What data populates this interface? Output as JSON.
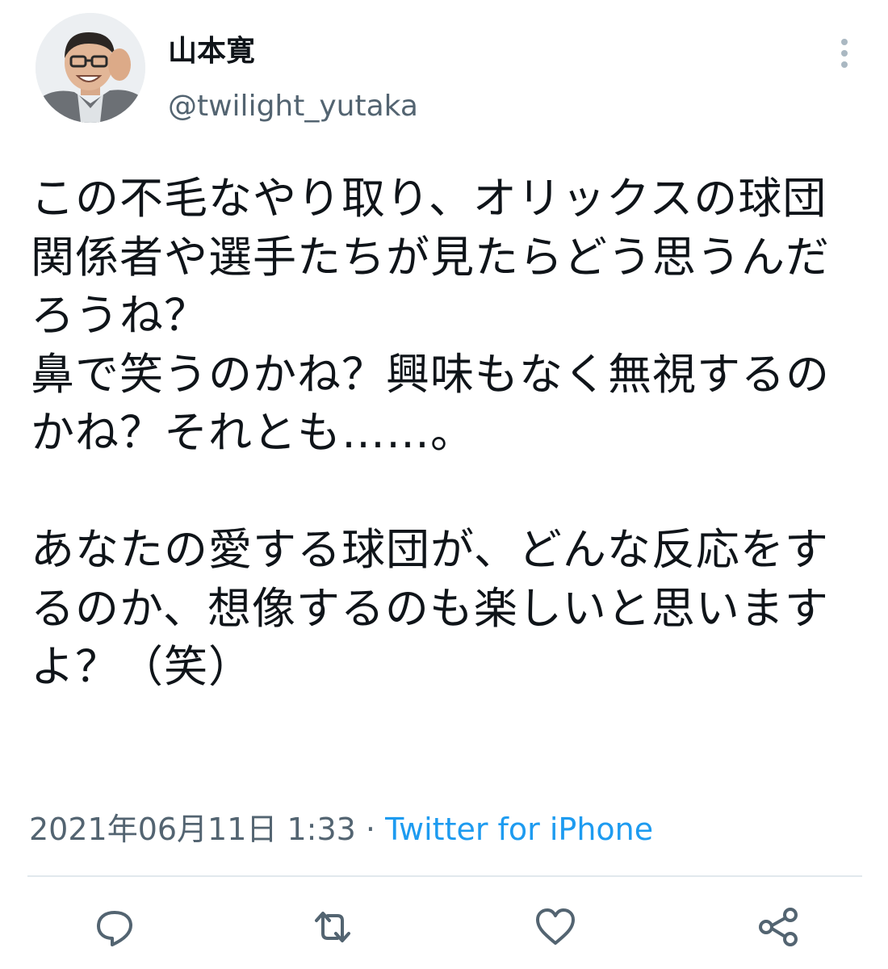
{
  "author": {
    "name": "山本寛",
    "handle": "@twilight_yutaka"
  },
  "tweet": {
    "text": "この不毛なやり取り、オリックスの球団関係者や選手たちが見たらどう思うんだろうね？\n鼻で笑うのかね？興味もなく無視するのかね？それとも……。\n\nあなたの愛する球団が、どんな反応をするのか、想像するのも楽しいと思いますよ？（笑）"
  },
  "meta": {
    "timestamp": "2021年06月11日 1:33",
    "separator": "·",
    "source": "Twitter for iPhone"
  },
  "icons": {
    "more": "more-vertical-icon",
    "reply": "reply-icon",
    "retweet": "retweet-icon",
    "like": "heart-icon",
    "share": "share-icon"
  },
  "colors": {
    "text": "#0f1419",
    "secondary": "#536471",
    "link": "#1d9bf0",
    "divider": "#e1e8ed",
    "icon": "#536471"
  }
}
